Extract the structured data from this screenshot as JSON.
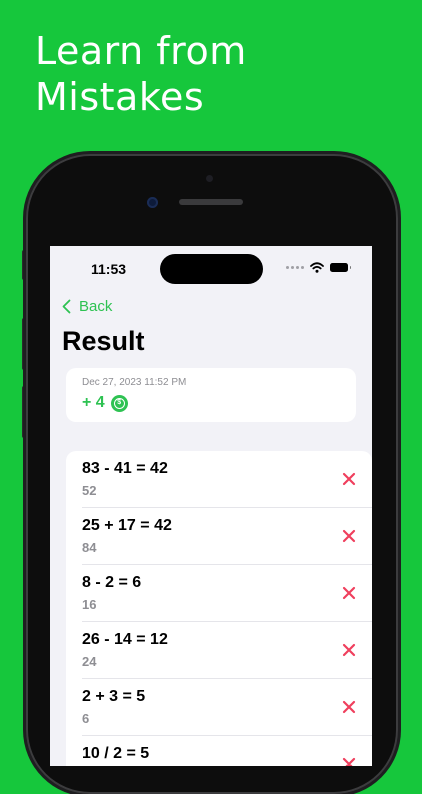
{
  "headline": {
    "line1": "Learn from",
    "line2": "Mistakes"
  },
  "status_bar": {
    "time": "11:53"
  },
  "nav": {
    "back_label": "Back",
    "title": "Result"
  },
  "summary": {
    "date": "Dec 27, 2023 11:52 PM",
    "score": "+ 4",
    "coin_glyph": "$"
  },
  "problems": [
    {
      "equation": "83 - 41 = 42",
      "answer": "52",
      "correct": false
    },
    {
      "equation": "25 + 17 = 42",
      "answer": "84",
      "correct": false
    },
    {
      "equation": "8 - 2 = 6",
      "answer": "16",
      "correct": false
    },
    {
      "equation": "26 - 14 = 12",
      "answer": "24",
      "correct": false
    },
    {
      "equation": "2 + 3 = 5",
      "answer": "6",
      "correct": false
    },
    {
      "equation": "10 / 2 = 5",
      "answer": "",
      "correct": false
    }
  ],
  "colors": {
    "background": "#16c73c",
    "accent": "#2ec252",
    "wrong": "#ef3f5d"
  },
  "icons": {
    "back": "chevron-left-icon",
    "coin": "coin-icon",
    "wrong": "close-icon",
    "wifi": "wifi-icon",
    "battery": "battery-icon"
  }
}
